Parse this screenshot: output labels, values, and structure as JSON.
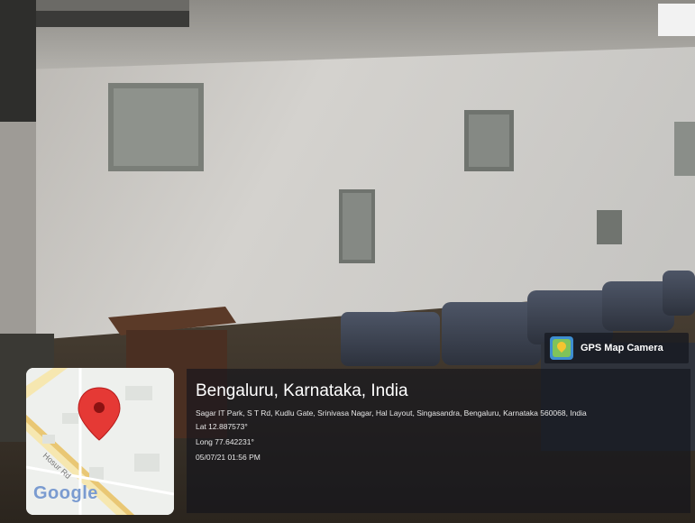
{
  "badge": {
    "label": "GPS Map Camera",
    "icon": "gps-map-camera-logo-icon"
  },
  "map": {
    "road_label": "Hosur Rd",
    "brand": "Google",
    "pin_color": "#e53935",
    "pin_icon": "map-pin-icon"
  },
  "location": {
    "title": "Bengaluru, Karnataka, India",
    "address": "Sagar IT Park, S T Rd, Kudlu Gate, Srinivasa Nagar, Hal Layout, Singasandra, Bengaluru, Karnataka 560068, India",
    "lat": "Lat 12.887573°",
    "long": "Long 77.642231°",
    "datetime": "05/07/21 01:56 PM"
  }
}
